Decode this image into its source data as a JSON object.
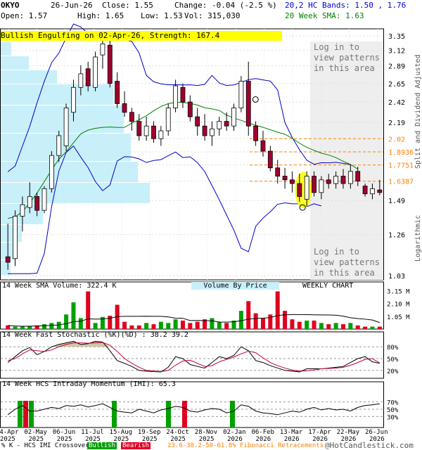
{
  "header": {
    "symbol": "OKYO",
    "date": "26-Jun-26",
    "close": "Close: 1.55",
    "change": "Change: -0.04 (-2.5 %)",
    "open": "Open: 1.57",
    "high": "High: 1.65",
    "low": "Low: 1.53",
    "vol": "Vol: 315,030",
    "bands": "20,2 HC Bands: 1.50 , 1.76",
    "sma": "20 Week SMA: 1.63"
  },
  "pattern_banner": "Bullish Engulfing on 02-Apr-26, Strength: 167.4",
  "login_text": [
    "Log in to",
    "view patterns",
    "in this area"
  ],
  "side_labels": {
    "logarithmic": "Logarithmic",
    "adjusted": "Split and Dividend Adjusted"
  },
  "price_axis": [
    "3.35",
    "3.12",
    "2.89",
    "2.65",
    "2.42",
    "2.19",
    "2.02",
    "1.8936",
    "1.7751",
    "1.6387",
    "1.49",
    "1.26",
    "1.03"
  ],
  "fib_levels": [
    {
      "label": "2.02",
      "value": 2.02
    },
    {
      "label": "1.8936",
      "value": 1.8936
    },
    {
      "label": "1.7751",
      "value": 1.7751
    },
    {
      "label": "1.6387",
      "value": 1.6387
    }
  ],
  "volume_panel": {
    "sma_label": "14 Week SMA Volume: 322.4 K",
    "vbp_label": "Volume By Price",
    "weekly": "WEEKLY CHART",
    "axis": [
      "3.15 M",
      "2.10 M",
      "1.05 M"
    ]
  },
  "stoch_panel": {
    "label": "14 Week Fast Stochastic (%K)(%D) : 38.2  39.2",
    "axis": [
      "80%",
      "50%",
      "20%"
    ]
  },
  "imi_panel": {
    "label": "14 Week HCS Intraday Momentum (IMI): 65.3",
    "axis": [
      "70%",
      "50%",
      "30%"
    ]
  },
  "x_axis": [
    {
      "d": "04-Apr",
      "y": "2025"
    },
    {
      "d": "02-May",
      "y": "2025"
    },
    {
      "d": "06-Jun",
      "y": "2025"
    },
    {
      "d": "11-Jul",
      "y": "2025"
    },
    {
      "d": "15-Aug",
      "y": "2025"
    },
    {
      "d": "19-Sep",
      "y": "2025"
    },
    {
      "d": "24-Oct",
      "y": "2025"
    },
    {
      "d": "28-Nov",
      "y": "2025"
    },
    {
      "d": "02-Jan",
      "y": "2026"
    },
    {
      "d": "06-Feb",
      "y": "2026"
    },
    {
      "d": "13-Mar",
      "y": "2026"
    },
    {
      "d": "17-Apr",
      "y": "2026"
    },
    {
      "d": "22-May",
      "y": "2026"
    },
    {
      "d": "26-Jun",
      "y": "2026"
    }
  ],
  "footer": {
    "left": "% K - HCS IMI Crossover,",
    "bullish": "Bullish",
    "bearish": "Bearish",
    "fib": "23.6-38.2-50-61.8% Fibonacci Retracements",
    "copyright": "@HotCandlestick.com"
  },
  "colors": {
    "bull": "#00a000",
    "bear": "#a00030",
    "upper_band": "#0000cc",
    "sma": "#008000",
    "fib": "#ff8000",
    "banner": "#ffff00",
    "vbp": "#c8f0fa"
  },
  "chart_data": {
    "type": "candlestick",
    "scale": "log",
    "ylim": [
      1.03,
      3.35
    ],
    "candles": [
      [
        1.13,
        1.33,
        1.06,
        1.1
      ],
      [
        1.12,
        1.42,
        1.08,
        1.38
      ],
      [
        1.38,
        1.52,
        1.28,
        1.46
      ],
      [
        1.44,
        1.63,
        1.4,
        1.52
      ],
      [
        1.52,
        1.55,
        1.38,
        1.42
      ],
      [
        1.42,
        1.6,
        1.4,
        1.58
      ],
      [
        1.58,
        1.9,
        1.55,
        1.86
      ],
      [
        1.86,
        2.1,
        1.8,
        2.05
      ],
      [
        1.95,
        2.4,
        1.9,
        2.35
      ],
      [
        2.3,
        2.7,
        2.2,
        2.6
      ],
      [
        2.6,
        2.9,
        2.5,
        2.78
      ],
      [
        2.85,
        2.95,
        2.55,
        2.62
      ],
      [
        2.6,
        3.1,
        2.55,
        3.02
      ],
      [
        3.05,
        3.35,
        2.85,
        3.22
      ],
      [
        3.2,
        3.3,
        2.6,
        2.65
      ],
      [
        2.68,
        2.8,
        2.35,
        2.4
      ],
      [
        2.4,
        2.55,
        2.25,
        2.3
      ],
      [
        2.3,
        2.35,
        2.1,
        2.2
      ],
      [
        2.2,
        2.28,
        2.0,
        2.05
      ],
      [
        2.05,
        2.25,
        2.0,
        2.15
      ],
      [
        2.15,
        2.2,
        1.98,
        2.02
      ],
      [
        2.02,
        2.15,
        1.95,
        2.1
      ],
      [
        2.1,
        2.4,
        2.05,
        2.35
      ],
      [
        2.35,
        2.7,
        2.3,
        2.62
      ],
      [
        2.6,
        2.65,
        2.35,
        2.42
      ],
      [
        2.42,
        2.5,
        2.2,
        2.25
      ],
      [
        2.25,
        2.35,
        2.05,
        2.15
      ],
      [
        2.15,
        2.28,
        2.0,
        2.05
      ],
      [
        2.05,
        2.2,
        1.95,
        2.12
      ],
      [
        2.12,
        2.25,
        2.05,
        2.2
      ],
      [
        2.2,
        2.3,
        2.1,
        2.15
      ],
      [
        2.15,
        2.4,
        2.1,
        2.35
      ],
      [
        2.35,
        2.75,
        2.3,
        2.68
      ],
      [
        2.68,
        2.95,
        2.05,
        2.15
      ],
      [
        2.15,
        2.2,
        1.95,
        2.0
      ],
      [
        2.0,
        2.1,
        1.85,
        1.9
      ],
      [
        1.9,
        1.95,
        1.72,
        1.75
      ],
      [
        1.75,
        1.82,
        1.62,
        1.68
      ],
      [
        1.68,
        1.75,
        1.58,
        1.65
      ],
      [
        1.65,
        1.72,
        1.55,
        1.62
      ],
      [
        1.62,
        1.7,
        1.48,
        1.52
      ],
      [
        1.5,
        1.72,
        1.45,
        1.68
      ],
      [
        1.68,
        1.72,
        1.52,
        1.55
      ],
      [
        1.55,
        1.68,
        1.5,
        1.65
      ],
      [
        1.65,
        1.7,
        1.58,
        1.62
      ],
      [
        1.62,
        1.72,
        1.58,
        1.68
      ],
      [
        1.68,
        1.74,
        1.58,
        1.62
      ],
      [
        1.62,
        1.78,
        1.58,
        1.72
      ],
      [
        1.72,
        1.76,
        1.6,
        1.64
      ],
      [
        1.6,
        1.62,
        1.52,
        1.54
      ],
      [
        1.54,
        1.62,
        1.5,
        1.58
      ],
      [
        1.57,
        1.65,
        1.53,
        1.55
      ]
    ],
    "volume_m": [
      0.3,
      0.2,
      0.2,
      0.25,
      0.3,
      0.4,
      0.5,
      0.6,
      1.2,
      2.2,
      0.9,
      3.1,
      0.5,
      1.0,
      1.1,
      2.0,
      0.6,
      0.3,
      0.3,
      0.5,
      0.4,
      0.6,
      0.5,
      0.8,
      0.7,
      0.5,
      0.6,
      0.8,
      0.9,
      0.6,
      0.5,
      0.7,
      1.5,
      2.3,
      1.3,
      0.9,
      1.2,
      3.1,
      1.5,
      0.8,
      0.6,
      0.7,
      0.7,
      0.5,
      0.4,
      0.5,
      0.4,
      0.5,
      0.3,
      0.2,
      0.2,
      0.2
    ],
    "stoch_k": [
      40,
      55,
      70,
      78,
      60,
      68,
      80,
      86,
      90,
      94,
      86,
      88,
      94,
      92,
      70,
      45,
      38,
      30,
      20,
      18,
      17,
      16,
      28,
      55,
      50,
      35,
      30,
      26,
      40,
      55,
      50,
      58,
      80,
      70,
      45,
      40,
      32,
      26,
      20,
      18,
      16,
      24,
      24,
      24,
      26,
      28,
      30,
      40,
      50,
      55,
      42,
      38
    ],
    "stoch_d": [
      45,
      50,
      62,
      72,
      70,
      68,
      72,
      80,
      86,
      90,
      90,
      89,
      90,
      91,
      84,
      68,
      50,
      38,
      28,
      20,
      18,
      17,
      20,
      33,
      44,
      46,
      38,
      30,
      32,
      42,
      48,
      54,
      62,
      69,
      65,
      52,
      40,
      32,
      26,
      21,
      18,
      19,
      21,
      24,
      25,
      26,
      28,
      33,
      40,
      48,
      50,
      39
    ],
    "imi": [
      35,
      50,
      60,
      45,
      45,
      50,
      55,
      52,
      60,
      58,
      62,
      56,
      60,
      65,
      55,
      45,
      42,
      40,
      50,
      45,
      40,
      48,
      52,
      58,
      55,
      45,
      42,
      48,
      52,
      50,
      40,
      45,
      62,
      58,
      45,
      40,
      38,
      35,
      40,
      45,
      42,
      50,
      55,
      48,
      52,
      48,
      50,
      45,
      55,
      60,
      62,
      65
    ]
  }
}
